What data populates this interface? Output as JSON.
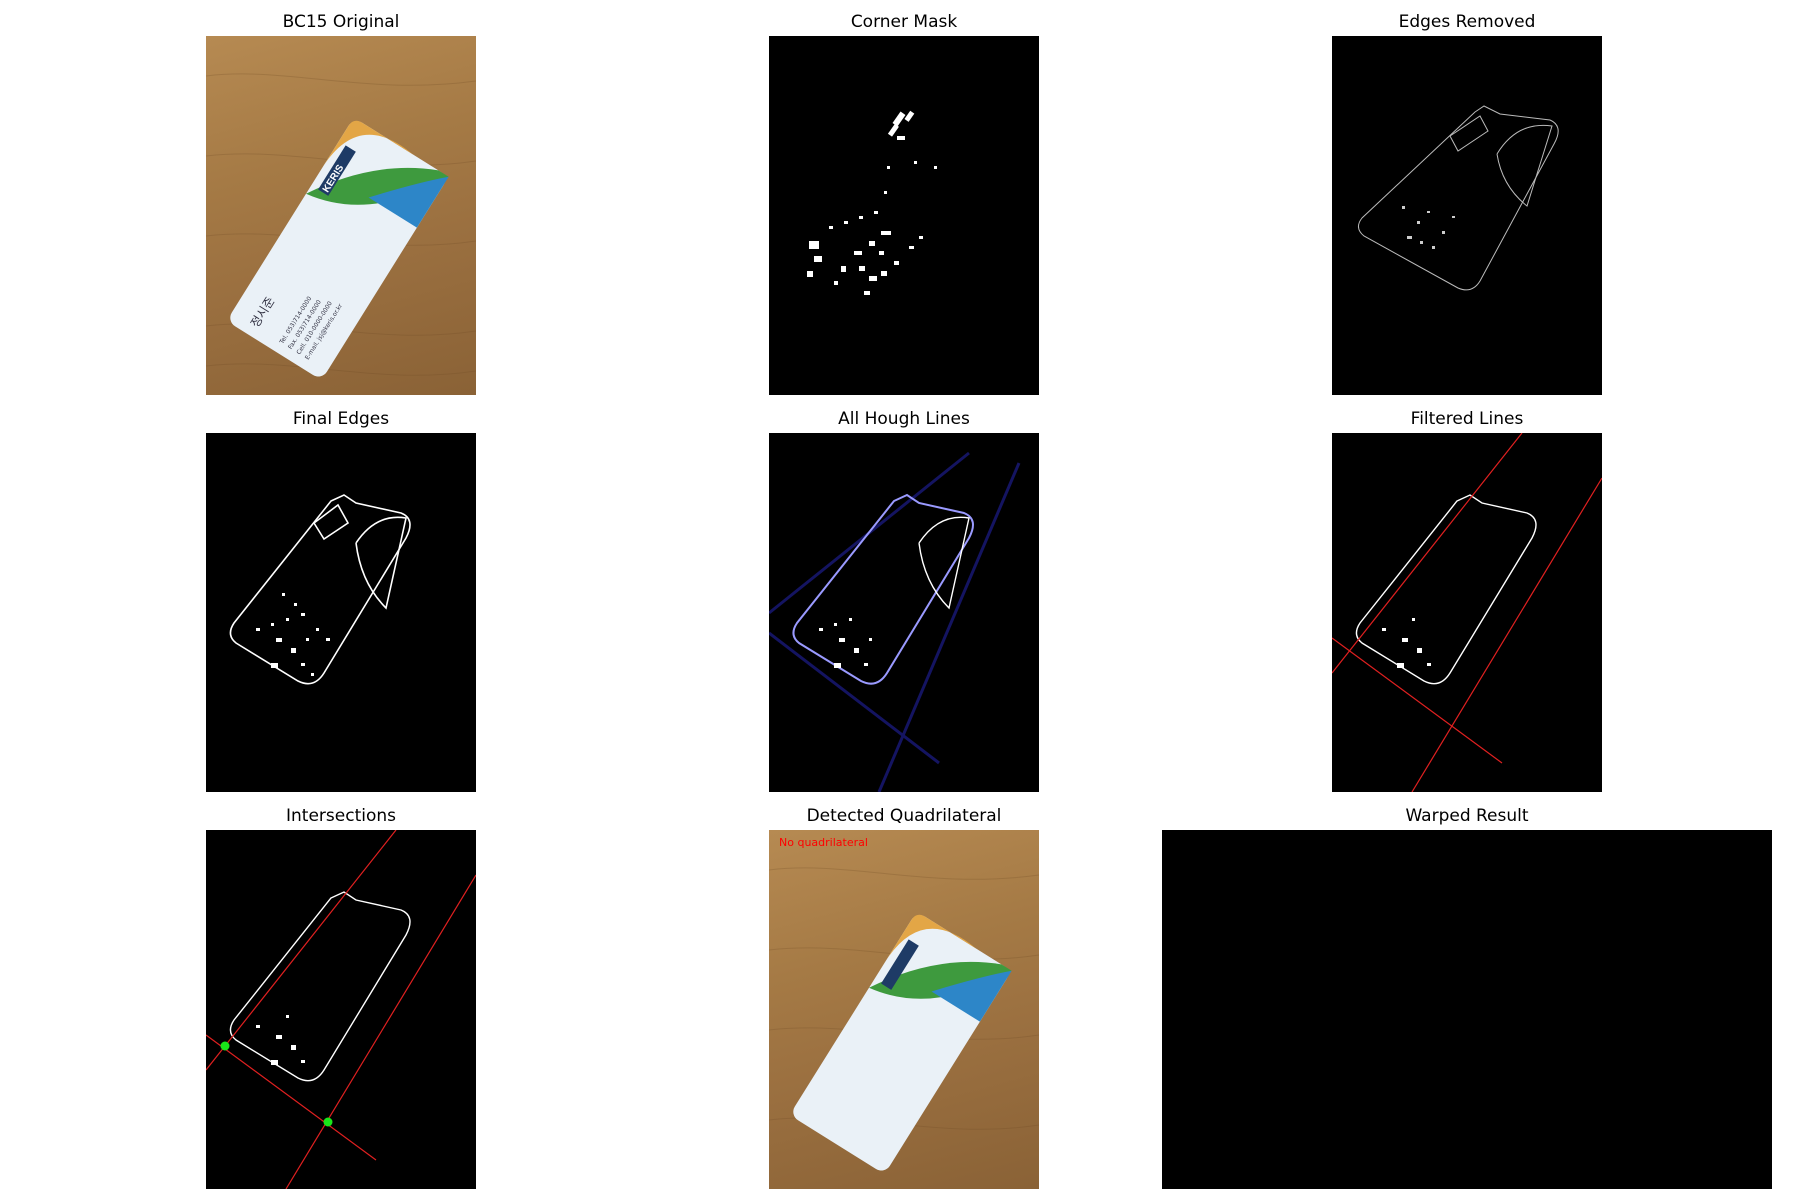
{
  "panels": [
    {
      "title": "BC15 Original"
    },
    {
      "title": "Corner Mask"
    },
    {
      "title": "Edges Removed"
    },
    {
      "title": "Final Edges"
    },
    {
      "title": "All Hough Lines"
    },
    {
      "title": "Filtered Lines"
    },
    {
      "title": "Intersections"
    },
    {
      "title": "Detected Quadrilateral",
      "overlay_text": "No quadrilateral"
    },
    {
      "title": "Warped Result"
    }
  ],
  "card": {
    "brand": "KERIS",
    "name": "정시준",
    "lines": [
      "Tel. 053)714-0000",
      "Fax. 053)714-0000",
      "Cell. 010-0000-0000",
      "E-mail. jsj@keris.or.kr"
    ]
  },
  "colors": {
    "line": "#e02020",
    "intersection": "#19e619",
    "hough": "#3a3aff",
    "overlay": "#ff0000"
  }
}
